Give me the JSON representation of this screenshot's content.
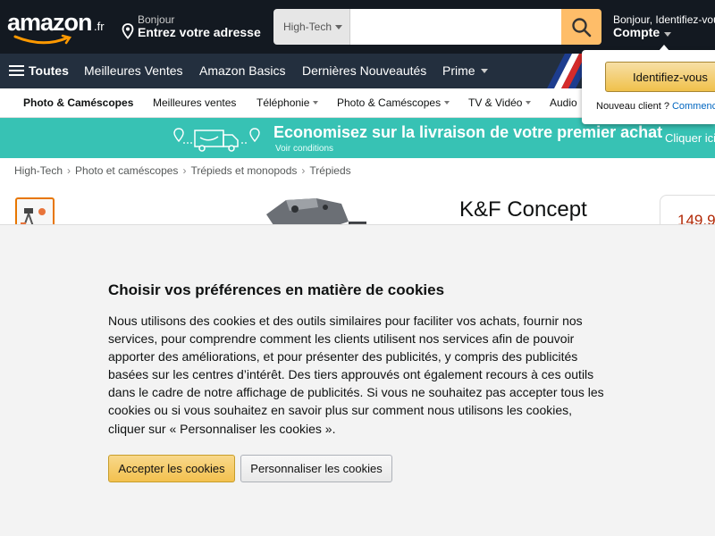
{
  "header": {
    "logo": "amazon",
    "logo_tld": ".fr",
    "deliver_line1": "Bonjour",
    "deliver_line2": "Entrez votre adresse",
    "search_category": "High-Tech",
    "search_value": "",
    "account_line1": "Bonjour, Identifiez-vous",
    "account_line2": "Compte"
  },
  "main_nav": {
    "all_label": "Toutes",
    "items": [
      "Meilleures Ventes",
      "Amazon Basics",
      "Dernières Nouveautés",
      "Prime"
    ]
  },
  "sub_nav": {
    "items": [
      "Photo & Caméscopes",
      "Meilleures ventes",
      "Téléphonie",
      "Photo & Caméscopes",
      "TV & Vidéo",
      "Audio"
    ]
  },
  "promo": {
    "headline": "Economisez sur la livraison de votre premier achat",
    "sub": "Voir conditions",
    "cta": "Cliquer ici"
  },
  "breadcrumb": [
    "High-Tech",
    "Photo et caméscopes",
    "Trépieds et monopods",
    "Trépieds"
  ],
  "product": {
    "brand": "K&F Concept",
    "price": "149,9"
  },
  "flyout": {
    "signin_label": "Identifiez-vous",
    "new_customer": "Nouveau client ?",
    "start_link": "Commencer ici."
  },
  "cookie": {
    "title": "Choisir vos préférences en matière de cookies",
    "body": "Nous utilisons des cookies et des outils similaires pour faciliter vos achats, fournir nos services, pour comprendre comment les clients utilisent nos services afin de pouvoir apporter des améliorations, et pour présenter des publicités, y compris des publicités basées sur les centres d’intérêt. Des tiers approuvés ont également recours à ces outils dans le cadre de notre affichage de publicités. Si vous ne souhaitez pas accepter tous les cookies ou si vous souhaitez en savoir plus sur comment nous utilisons les cookies, cliquer sur « Personnaliser les cookies ».",
    "accept_label": "Accepter les cookies",
    "customize_label": "Personnaliser les cookies"
  },
  "colors": {
    "header_bg": "#131921",
    "nav_bg": "#232f3e",
    "search_button": "#febd69",
    "promo_bg": "#37c2b4",
    "accent_button": "#f0c14b",
    "price": "#b12704"
  },
  "icons": [
    "amazon-smile-logo",
    "location-pin-icon",
    "search-icon",
    "hamburger-menu-icon",
    "delivery-truck-icon",
    "chevron-down-icon"
  ]
}
